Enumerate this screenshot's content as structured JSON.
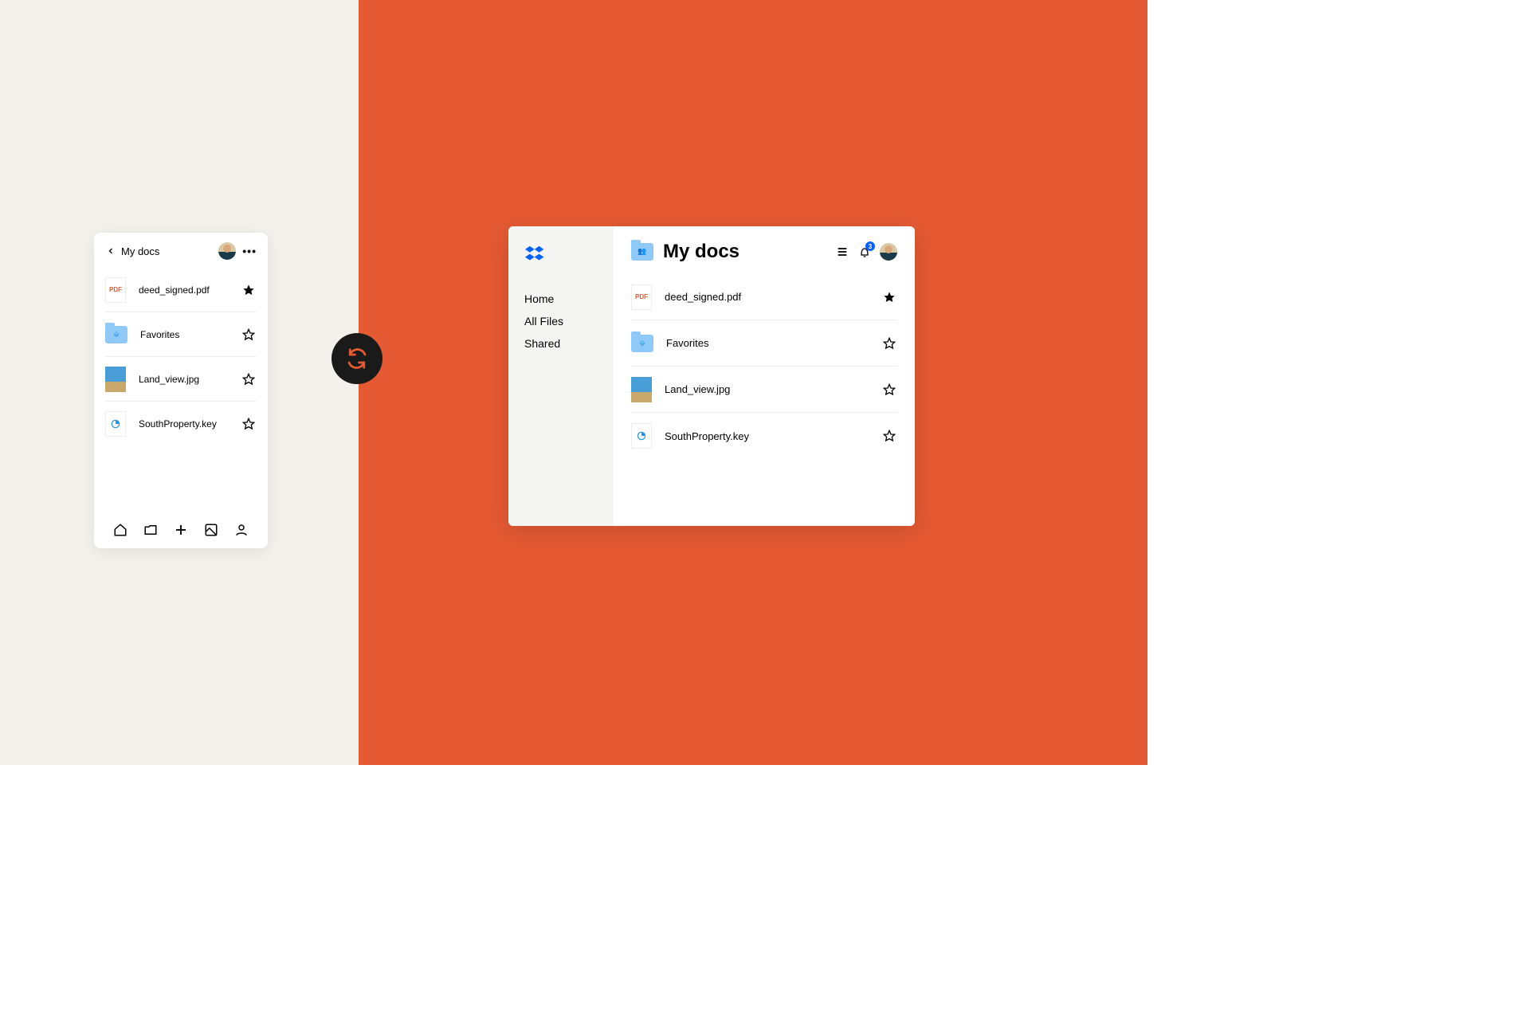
{
  "folder_title": "My docs",
  "notification_count": "3",
  "sidebar": {
    "items": [
      {
        "label": "Home"
      },
      {
        "label": "All Files"
      },
      {
        "label": "Shared"
      }
    ]
  },
  "files": [
    {
      "name": "deed_signed.pdf",
      "type": "pdf",
      "thumb_text": "PDF",
      "starred": true
    },
    {
      "name": "Favorites",
      "type": "folder",
      "starred": false
    },
    {
      "name": "Land_view.jpg",
      "type": "image",
      "starred": false
    },
    {
      "name": "SouthProperty.key",
      "type": "key",
      "starred": false
    }
  ]
}
